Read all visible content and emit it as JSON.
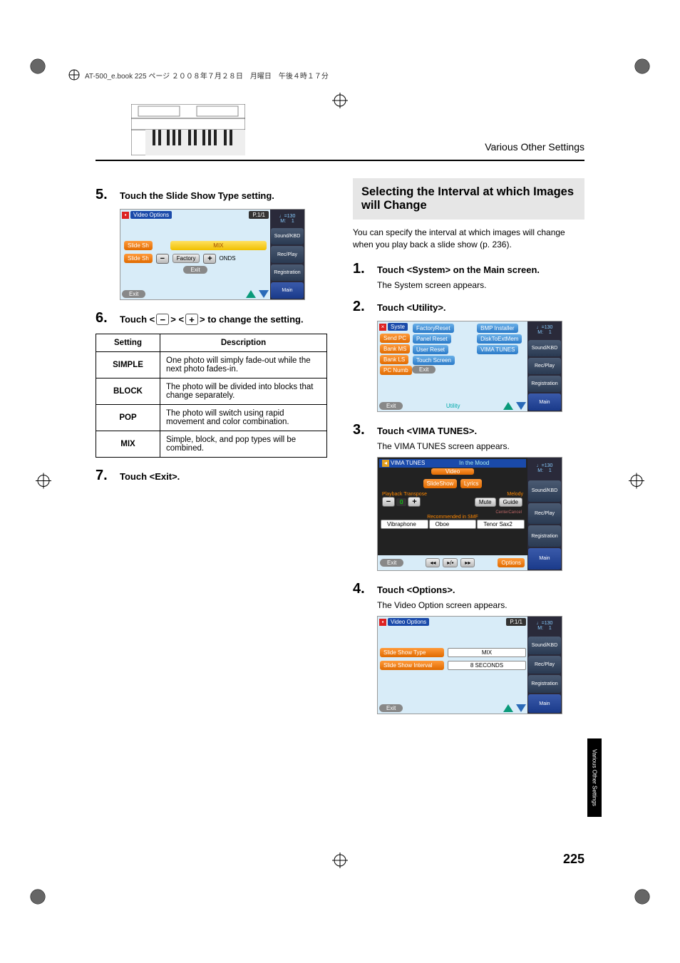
{
  "header_strip": "AT-500_e.book  225 ページ  ２００８年７月２８日　月曜日　午後４時１７分",
  "running_head": "Various Other Settings",
  "page_number": "225",
  "side_tab": "Various Other Settings",
  "left": {
    "step5": {
      "num": "5.",
      "text": "Touch the Slide Show Type setting."
    },
    "step6_prefix": "Touch <",
    "step6_mid": "> <",
    "step6_suffix": "> to change the setting.",
    "step6_num": "6.",
    "minus": "−",
    "plus": "+",
    "table": {
      "head_setting": "Setting",
      "head_desc": "Description",
      "rows": [
        {
          "k": "SIMPLE",
          "v": "One photo will simply fade-out while the next photo fades-in."
        },
        {
          "k": "BLOCK",
          "v": "The photo will be divided into blocks that change separately."
        },
        {
          "k": "POP",
          "v": "The photo will switch using rapid movement and color combination."
        },
        {
          "k": "MIX",
          "v": "Simple, block, and pop types will be combined."
        }
      ]
    },
    "step7": {
      "num": "7.",
      "text": "Touch <Exit>."
    },
    "shot1": {
      "title": "Video Options",
      "page_ind": "P.1/1",
      "row1": "Slide Sh",
      "row2": "Slide Sh",
      "factory": "Factory",
      "mix": "MIX",
      "onds": "ONDS",
      "exit": "Exit",
      "side_tempo": "♩=130\nM:    1",
      "side_sound": "Sound/KBD",
      "side_rec": "Rec/Play",
      "side_reg": "Registration",
      "side_main": "Main"
    }
  },
  "right": {
    "section_title": "Selecting the Interval at which Images will Change",
    "intro": "You can specify the interval at which images will change when you play back a slide show (p. 236).",
    "step1": {
      "num": "1.",
      "text": "Touch <System> on the Main screen.",
      "sub": "The System screen appears."
    },
    "step2": {
      "num": "2.",
      "text": "Touch <Utility>."
    },
    "step3": {
      "num": "3.",
      "text": "Touch <VIMA TUNES>.",
      "sub": "The VIMA TUNES screen appears."
    },
    "step4": {
      "num": "4.",
      "text": "Touch <Options>.",
      "sub": "The Video Option screen appears."
    },
    "shot2": {
      "syste": "Syste",
      "sendpc": "Send PC",
      "bankms": "Bank MS",
      "bankls": "Bank LS",
      "pcnum": "PC Numb",
      "factoryreset": "FactoryReset",
      "bmp": "BMP Installer",
      "panelreset": "Panel Reset",
      "disk": "DiskToExtMem",
      "userreset": "User Reset",
      "vima": "VIMA TUNES",
      "touchscreen": "Touch Screen",
      "exit": "Exit",
      "exit2": "Exit",
      "utility": "Utility"
    },
    "shot3": {
      "title": "VIMA TUNES",
      "song": "In the Mood",
      "video": "Video",
      "slideshow": "SlideShow",
      "lyrics": "Lyrics",
      "playback": "Playback Transpose",
      "melody": "Melody",
      "mute": "Mute",
      "guide": "Guide",
      "centercancel": "CenterCancel",
      "recommended": "Recommended in SMF",
      "inst1": "Vibraphone",
      "inst2": "Oboe",
      "inst3": "Tenor Sax2",
      "exit": "Exit",
      "options": "Options",
      "rew": "◂◂",
      "play": "▸/▪",
      "fwd": "▸▸",
      "zero": "0"
    },
    "shot4": {
      "title": "Video Options",
      "page_ind": "P.1/1",
      "row1": "Slide Show Type",
      "row1v": "MIX",
      "row2": "Slide Show Interval",
      "row2v": "8 SECONDS",
      "exit": "Exit"
    },
    "side_tempo": "♩=130\nM:    1",
    "side_sound": "Sound/KBD",
    "side_rec": "Rec/Play",
    "side_reg": "Registration",
    "side_main": "Main"
  }
}
